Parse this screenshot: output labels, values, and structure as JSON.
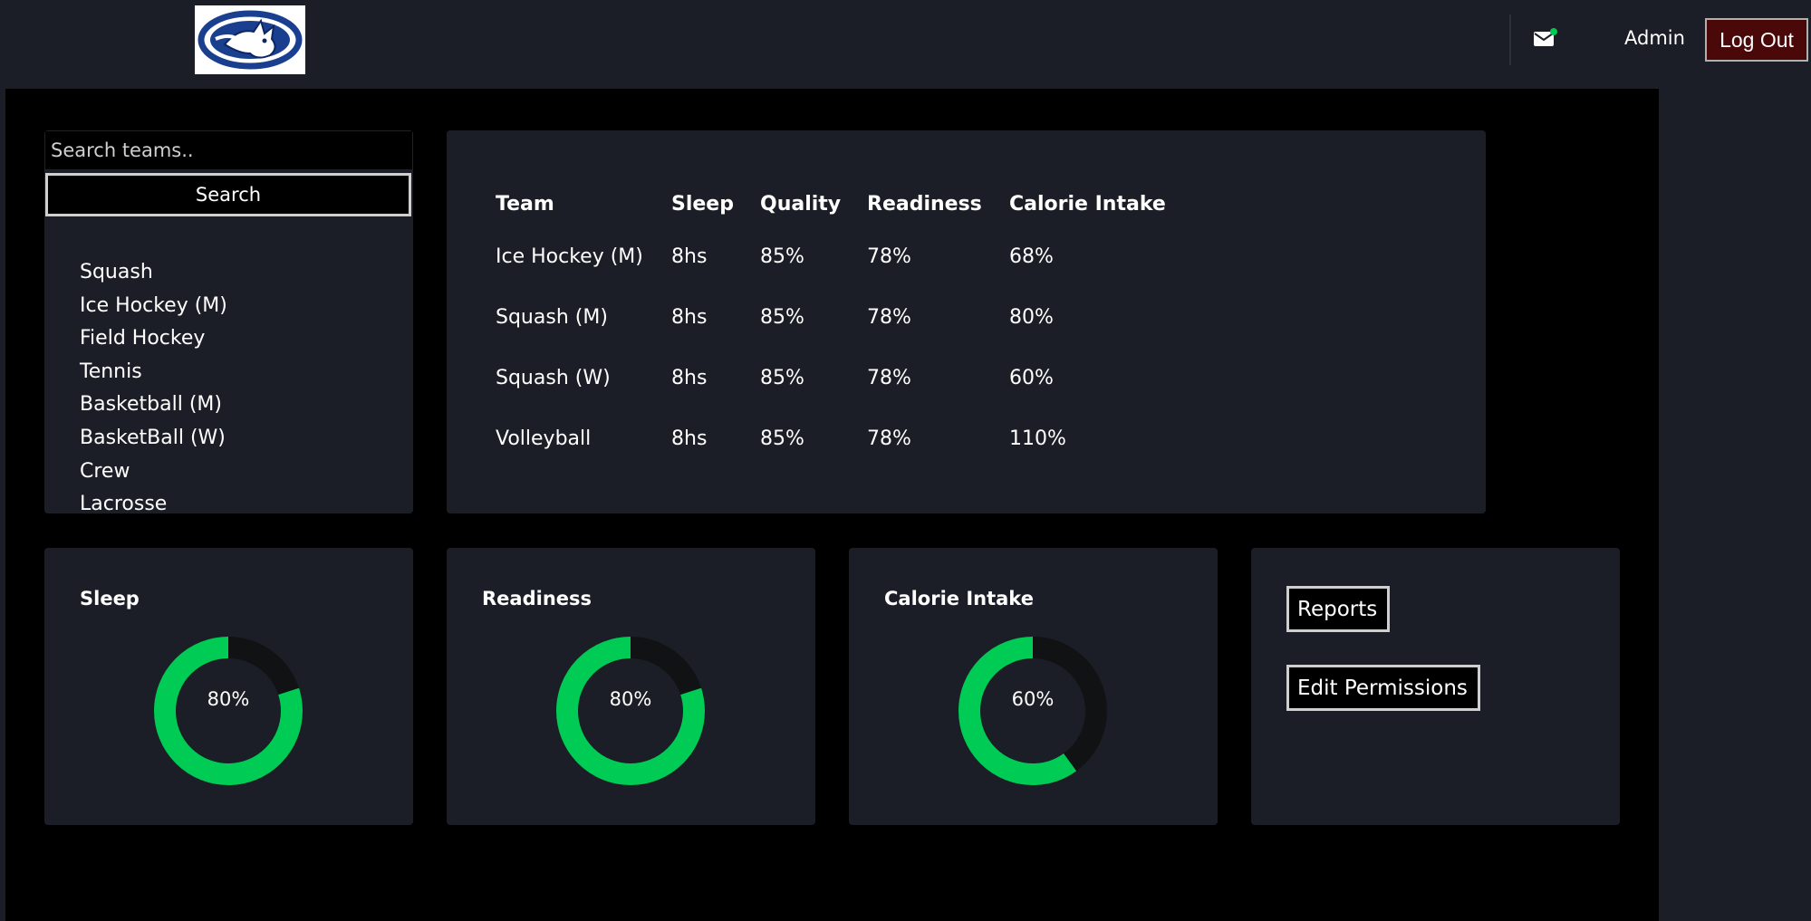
{
  "header": {
    "admin_label": "Admin",
    "logout_label": "Log Out",
    "accent": "#4a0808",
    "notification_dot": "#00c853"
  },
  "sidebar": {
    "search_placeholder": "Search teams..",
    "search_label": "Search",
    "teams": [
      "Squash",
      "Ice Hockey (M)",
      "Field Hockey",
      "Tennis",
      "Basketball (M)",
      "BasketBall (W)",
      "Crew",
      "Lacrosse"
    ]
  },
  "table": {
    "headers": [
      "Team",
      "Sleep",
      "Quality",
      "Readiness",
      "Calorie Intake"
    ],
    "rows": [
      [
        "Ice Hockey (M)",
        "8hs",
        "85%",
        "78%",
        "68%"
      ],
      [
        "Squash (M)",
        "8hs",
        "85%",
        "78%",
        "80%"
      ],
      [
        "Squash (W)",
        "8hs",
        "85%",
        "78%",
        "60%"
      ],
      [
        "Volleyball",
        "8hs",
        "85%",
        "78%",
        "110%"
      ]
    ]
  },
  "donuts": [
    {
      "title": "Sleep",
      "label": "80%",
      "fraction": 0.8
    },
    {
      "title": "Readiness",
      "label": "80%",
      "fraction": 0.8
    },
    {
      "title": "Calorie Intake",
      "label": "60%",
      "fraction": 0.6
    }
  ],
  "donut_color": "#00cc55",
  "donut_track": "#111214",
  "actions": {
    "reports_label": "Reports",
    "permissions_label": "Edit Permissions"
  }
}
